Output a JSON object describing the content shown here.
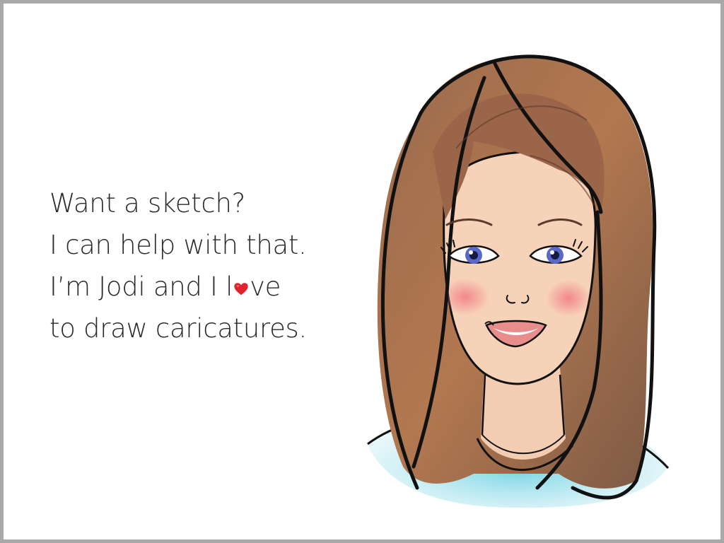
{
  "message": {
    "line1": "Want a sketch?",
    "line2": "I can help with that.",
    "line3_before": "I’m Jodi and I l",
    "line3_after": "ve",
    "line4": "to draw caricatures."
  },
  "colors": {
    "text": "#2a2a2a",
    "border": "#a8a8a8",
    "heart": "#e0242b",
    "hair": "#8a5a3c",
    "skin": "#f6d2b8",
    "eyes": "#5a68c8",
    "shirt": "#7fd3df"
  },
  "icons": {
    "heart": "heart-icon"
  }
}
